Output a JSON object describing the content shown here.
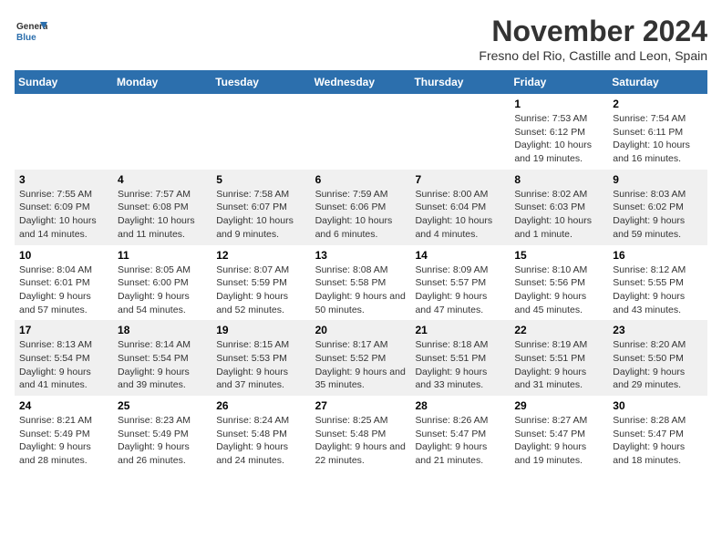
{
  "header": {
    "logo_line1": "General",
    "logo_line2": "Blue",
    "month_title": "November 2024",
    "location": "Fresno del Rio, Castille and Leon, Spain"
  },
  "weekdays": [
    "Sunday",
    "Monday",
    "Tuesday",
    "Wednesday",
    "Thursday",
    "Friday",
    "Saturday"
  ],
  "weeks": [
    [
      {
        "day": "",
        "info": ""
      },
      {
        "day": "",
        "info": ""
      },
      {
        "day": "",
        "info": ""
      },
      {
        "day": "",
        "info": ""
      },
      {
        "day": "",
        "info": ""
      },
      {
        "day": "1",
        "info": "Sunrise: 7:53 AM\nSunset: 6:12 PM\nDaylight: 10 hours and 19 minutes."
      },
      {
        "day": "2",
        "info": "Sunrise: 7:54 AM\nSunset: 6:11 PM\nDaylight: 10 hours and 16 minutes."
      }
    ],
    [
      {
        "day": "3",
        "info": "Sunrise: 7:55 AM\nSunset: 6:09 PM\nDaylight: 10 hours and 14 minutes."
      },
      {
        "day": "4",
        "info": "Sunrise: 7:57 AM\nSunset: 6:08 PM\nDaylight: 10 hours and 11 minutes."
      },
      {
        "day": "5",
        "info": "Sunrise: 7:58 AM\nSunset: 6:07 PM\nDaylight: 10 hours and 9 minutes."
      },
      {
        "day": "6",
        "info": "Sunrise: 7:59 AM\nSunset: 6:06 PM\nDaylight: 10 hours and 6 minutes."
      },
      {
        "day": "7",
        "info": "Sunrise: 8:00 AM\nSunset: 6:04 PM\nDaylight: 10 hours and 4 minutes."
      },
      {
        "day": "8",
        "info": "Sunrise: 8:02 AM\nSunset: 6:03 PM\nDaylight: 10 hours and 1 minute."
      },
      {
        "day": "9",
        "info": "Sunrise: 8:03 AM\nSunset: 6:02 PM\nDaylight: 9 hours and 59 minutes."
      }
    ],
    [
      {
        "day": "10",
        "info": "Sunrise: 8:04 AM\nSunset: 6:01 PM\nDaylight: 9 hours and 57 minutes."
      },
      {
        "day": "11",
        "info": "Sunrise: 8:05 AM\nSunset: 6:00 PM\nDaylight: 9 hours and 54 minutes."
      },
      {
        "day": "12",
        "info": "Sunrise: 8:07 AM\nSunset: 5:59 PM\nDaylight: 9 hours and 52 minutes."
      },
      {
        "day": "13",
        "info": "Sunrise: 8:08 AM\nSunset: 5:58 PM\nDaylight: 9 hours and 50 minutes."
      },
      {
        "day": "14",
        "info": "Sunrise: 8:09 AM\nSunset: 5:57 PM\nDaylight: 9 hours and 47 minutes."
      },
      {
        "day": "15",
        "info": "Sunrise: 8:10 AM\nSunset: 5:56 PM\nDaylight: 9 hours and 45 minutes."
      },
      {
        "day": "16",
        "info": "Sunrise: 8:12 AM\nSunset: 5:55 PM\nDaylight: 9 hours and 43 minutes."
      }
    ],
    [
      {
        "day": "17",
        "info": "Sunrise: 8:13 AM\nSunset: 5:54 PM\nDaylight: 9 hours and 41 minutes."
      },
      {
        "day": "18",
        "info": "Sunrise: 8:14 AM\nSunset: 5:54 PM\nDaylight: 9 hours and 39 minutes."
      },
      {
        "day": "19",
        "info": "Sunrise: 8:15 AM\nSunset: 5:53 PM\nDaylight: 9 hours and 37 minutes."
      },
      {
        "day": "20",
        "info": "Sunrise: 8:17 AM\nSunset: 5:52 PM\nDaylight: 9 hours and 35 minutes."
      },
      {
        "day": "21",
        "info": "Sunrise: 8:18 AM\nSunset: 5:51 PM\nDaylight: 9 hours and 33 minutes."
      },
      {
        "day": "22",
        "info": "Sunrise: 8:19 AM\nSunset: 5:51 PM\nDaylight: 9 hours and 31 minutes."
      },
      {
        "day": "23",
        "info": "Sunrise: 8:20 AM\nSunset: 5:50 PM\nDaylight: 9 hours and 29 minutes."
      }
    ],
    [
      {
        "day": "24",
        "info": "Sunrise: 8:21 AM\nSunset: 5:49 PM\nDaylight: 9 hours and 28 minutes."
      },
      {
        "day": "25",
        "info": "Sunrise: 8:23 AM\nSunset: 5:49 PM\nDaylight: 9 hours and 26 minutes."
      },
      {
        "day": "26",
        "info": "Sunrise: 8:24 AM\nSunset: 5:48 PM\nDaylight: 9 hours and 24 minutes."
      },
      {
        "day": "27",
        "info": "Sunrise: 8:25 AM\nSunset: 5:48 PM\nDaylight: 9 hours and 22 minutes."
      },
      {
        "day": "28",
        "info": "Sunrise: 8:26 AM\nSunset: 5:47 PM\nDaylight: 9 hours and 21 minutes."
      },
      {
        "day": "29",
        "info": "Sunrise: 8:27 AM\nSunset: 5:47 PM\nDaylight: 9 hours and 19 minutes."
      },
      {
        "day": "30",
        "info": "Sunrise: 8:28 AM\nSunset: 5:47 PM\nDaylight: 9 hours and 18 minutes."
      }
    ]
  ]
}
